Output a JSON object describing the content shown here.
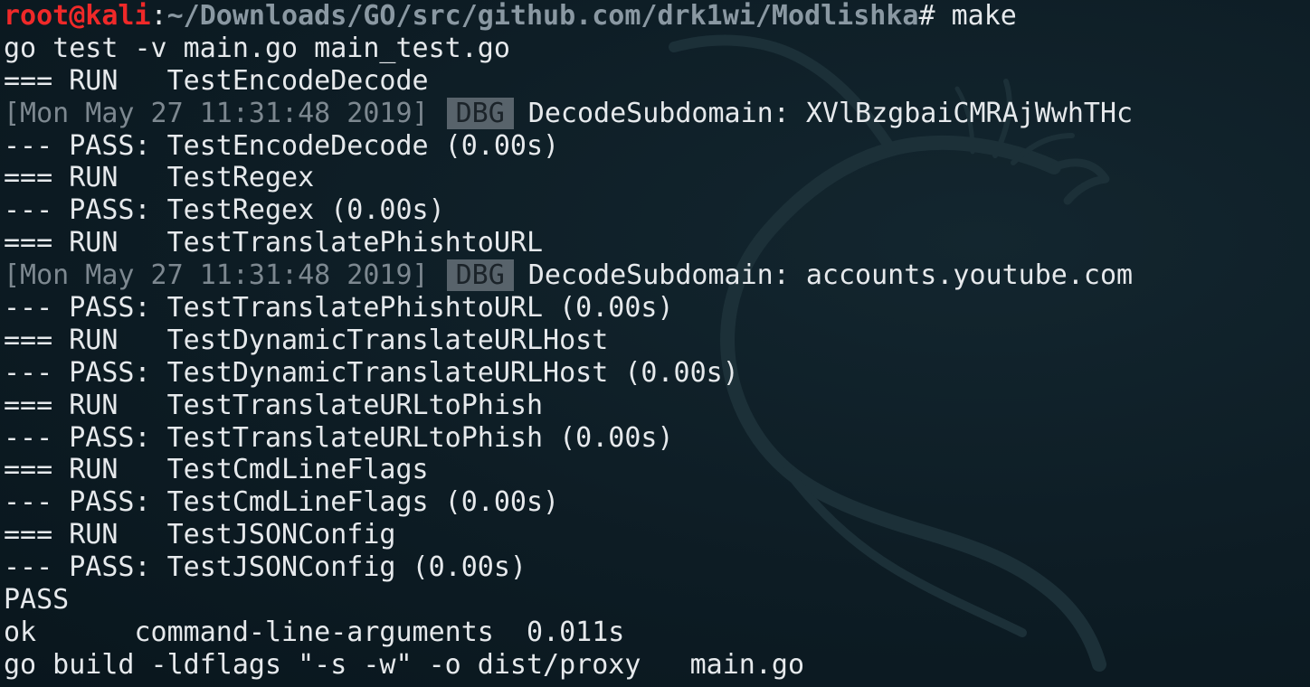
{
  "colors": {
    "background": "#0d1c24",
    "text": "#e6e9ec",
    "prompt_user": "#ef2929",
    "prompt_path": "#8a98a2",
    "timestamp": "#7d8890",
    "badge_bg": "#58636b"
  },
  "background_icon": "kali-dragon-icon",
  "prompt": {
    "user_host": "root@kali",
    "separator": ":",
    "path": "~/Downloads/GO/src/github.com/drk1wi/Modlishka",
    "symbol": "#",
    "command": " make"
  },
  "output": [
    "go test -v main.go main_test.go",
    "=== RUN   TestEncodeDecode",
    {
      "timestamp": "[Mon May 27 11:31:48 2019]",
      "level": "DBG",
      "message": "DecodeSubdomain: XVlBzgbaiCMRAjWwhTHc"
    },
    "--- PASS: TestEncodeDecode (0.00s)",
    "=== RUN   TestRegex",
    "--- PASS: TestRegex (0.00s)",
    "=== RUN   TestTranslatePhishtoURL",
    {
      "timestamp": "[Mon May 27 11:31:48 2019]",
      "level": "DBG",
      "message": "DecodeSubdomain: accounts.youtube.com"
    },
    "--- PASS: TestTranslatePhishtoURL (0.00s)",
    "=== RUN   TestDynamicTranslateURLHost",
    "--- PASS: TestDynamicTranslateURLHost (0.00s)",
    "=== RUN   TestTranslateURLtoPhish",
    "--- PASS: TestTranslateURLtoPhish (0.00s)",
    "=== RUN   TestCmdLineFlags",
    "--- PASS: TestCmdLineFlags (0.00s)",
    "=== RUN   TestJSONConfig",
    "--- PASS: TestJSONConfig (0.00s)",
    "PASS",
    "ok      command-line-arguments  0.011s",
    "go build -ldflags \"-s -w\" -o dist/proxy   main.go"
  ]
}
